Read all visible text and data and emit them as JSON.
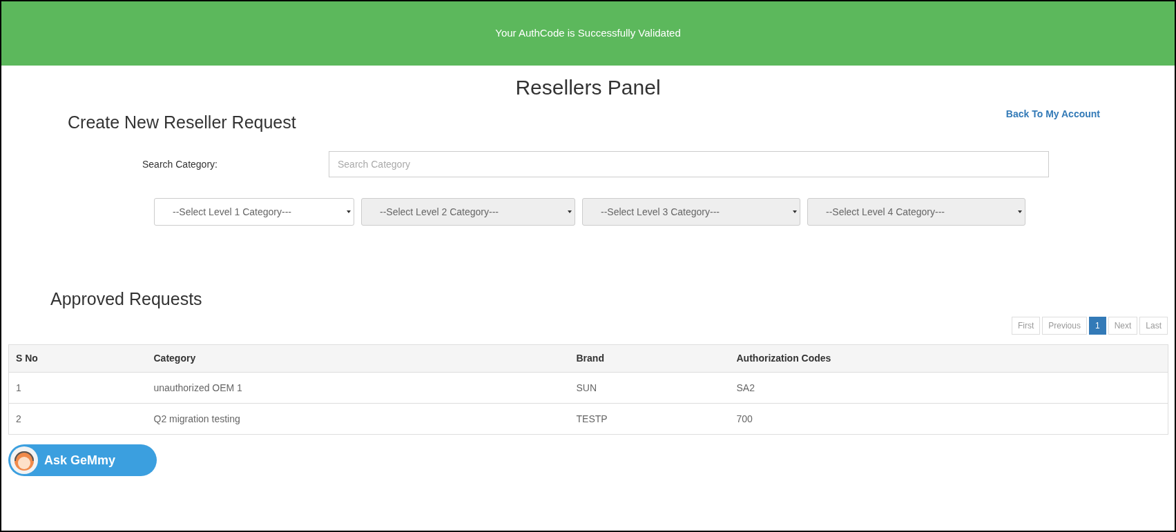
{
  "banner": {
    "message": "Your AuthCode is Successfully Validated"
  },
  "page_title": "Resellers Panel",
  "create_section": {
    "heading": "Create New Reseller Request",
    "back_link": "Back To My Account",
    "search": {
      "label": "Search Category:",
      "placeholder": "Search Category"
    },
    "selects": [
      {
        "label": "--Select Level 1 Category---",
        "disabled": false
      },
      {
        "label": "--Select Level 2 Category---",
        "disabled": true
      },
      {
        "label": "--Select Level 3 Category---",
        "disabled": true
      },
      {
        "label": "--Select Level 4 Category---",
        "disabled": true
      }
    ]
  },
  "approved_section": {
    "heading": "Approved Requests",
    "pagination": [
      {
        "label": "First",
        "selected": false
      },
      {
        "label": "Previous",
        "selected": false
      },
      {
        "label": "1",
        "selected": true
      },
      {
        "label": "Next",
        "selected": false
      },
      {
        "label": "Last",
        "selected": false
      }
    ],
    "table": {
      "columns": [
        "S No",
        "Category",
        "Brand",
        "Authorization Codes"
      ],
      "rows": [
        [
          "1",
          "unauthorized OEM 1",
          "SUN",
          "SA2"
        ],
        [
          "2",
          "Q2 migration testing",
          "TESTP",
          "700"
        ]
      ]
    }
  },
  "chat_button": {
    "label": "Ask GeMmy"
  }
}
